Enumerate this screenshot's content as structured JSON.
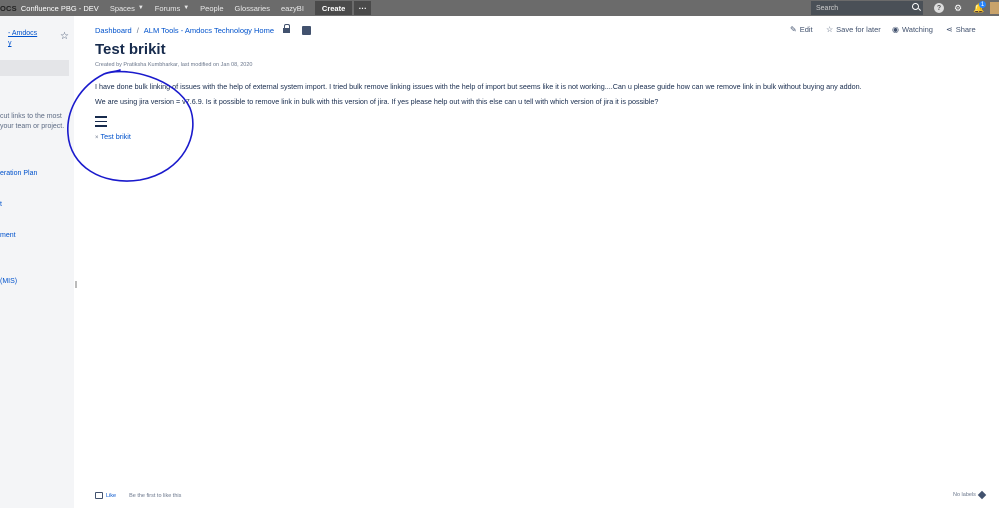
{
  "topnav": {
    "logo": "OCS",
    "space": "Confluence PBG - DEV",
    "items": [
      {
        "label": "Spaces",
        "caret": true
      },
      {
        "label": "Forums",
        "caret": true
      },
      {
        "label": "People",
        "caret": false
      },
      {
        "label": "Glossaries",
        "caret": false
      },
      {
        "label": "eazyBI",
        "caret": false
      }
    ],
    "create_label": "Create",
    "more_label": "···",
    "search_placeholder": "Search",
    "help_glyph": "?",
    "gear_glyph": "⚙",
    "bell_glyph": "🔔",
    "notification_count": "1"
  },
  "sidebar": {
    "space_link_line1": "- Amdocs",
    "space_link_line2": "y",
    "description_line1": "cut links to the most",
    "description_line2": "your team or project.",
    "items": [
      {
        "label": "eration Plan"
      },
      {
        "label": "t"
      },
      {
        "label": "ment"
      },
      {
        "label": "(MIS)"
      }
    ]
  },
  "breadcrumb": {
    "items": [
      "Dashboard",
      "ALM Tools - Amdocs Technology Home"
    ],
    "separator": "/"
  },
  "actions": {
    "edit": "Edit",
    "save_for_later": "Save for later",
    "watching": "Watching",
    "share": "Share"
  },
  "page": {
    "title": "Test brikit",
    "byline": "Created by Pratiksha Kumbharkar, last modified on Jan 08, 2020",
    "para1": "I have done bulk linking of issues with the help of external system import. I tried bulk remove linking issues with the help of import but seems like it is not working....Can u please guide how can we remove link in bulk without buying any addon.",
    "para2": "We are using jira version = v7.6.9. Is it possible to remove link in bulk with this version of jira. If yes please help out with this else can u tell with which version of jira it is possible?",
    "child_x": "×",
    "child_link": "Test brikit"
  },
  "footer": {
    "like": "Like",
    "first_to_like": "Be the first to like this",
    "no_labels": "No labels"
  },
  "colors": {
    "topnav": "#6b6b6b",
    "link": "#0052cc",
    "annotation": "#1a1acc"
  }
}
